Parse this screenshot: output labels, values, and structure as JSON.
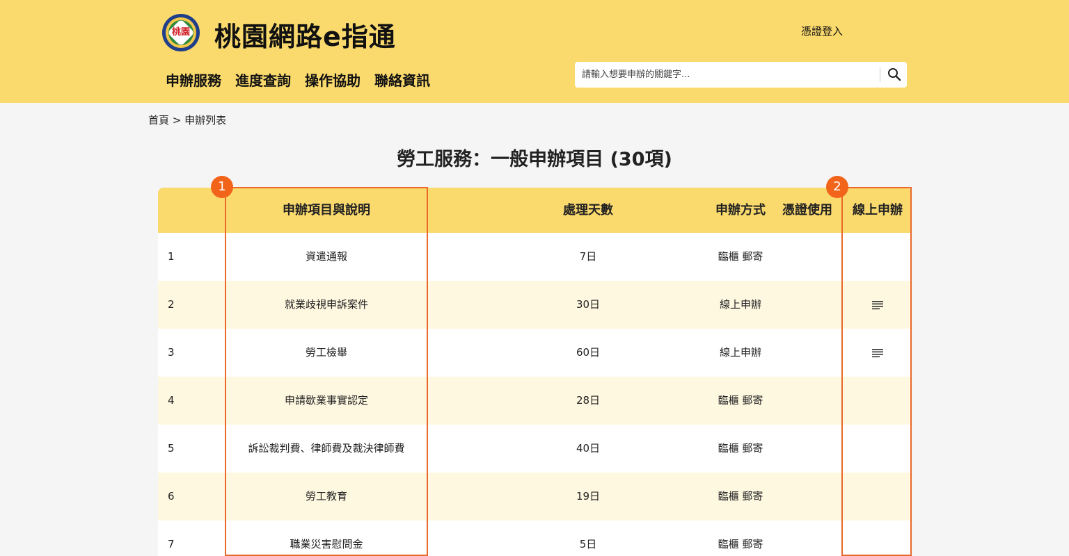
{
  "header": {
    "logo_text": "桃園",
    "site_title": "桃園網路e指通",
    "login_label": "憑證登入",
    "nav": [
      "申辦服務",
      "進度查詢",
      "操作協助",
      "聯絡資訊"
    ],
    "search_placeholder": "請輸入想要申辦的關鍵字..."
  },
  "breadcrumb": "首頁 > 申辦列表",
  "page_title": "勞工服務：一般申辦項目 (30項)",
  "table": {
    "headers": {
      "name": "申辦項目與說明",
      "days": "處理天數",
      "method": "申辦方式",
      "cert": "憑證使用",
      "online": "線上申辦"
    },
    "rows": [
      {
        "num": "1",
        "name": "資遣通報",
        "days": "7日",
        "method": "臨櫃 郵寄",
        "online": false
      },
      {
        "num": "2",
        "name": "就業歧視申訴案件",
        "days": "30日",
        "method": "線上申辦",
        "online": true
      },
      {
        "num": "3",
        "name": "勞工檢舉",
        "days": "60日",
        "method": "線上申辦",
        "online": true
      },
      {
        "num": "4",
        "name": "申請歇業事實認定",
        "days": "28日",
        "method": "臨櫃 郵寄",
        "online": false
      },
      {
        "num": "5",
        "name": "訴訟裁判費、律師費及裁決律師費",
        "days": "40日",
        "method": "臨櫃 郵寄",
        "online": false
      },
      {
        "num": "6",
        "name": "勞工教育",
        "days": "19日",
        "method": "臨櫃 郵寄",
        "online": false
      },
      {
        "num": "7",
        "name": "職業災害慰問金",
        "days": "5日",
        "method": "臨櫃 郵寄",
        "online": false
      }
    ]
  },
  "annotations": [
    "1",
    "2"
  ],
  "colors": {
    "header_bg": "#fad96d",
    "row_alt": "#fff8e1",
    "annotation": "#f26419"
  }
}
